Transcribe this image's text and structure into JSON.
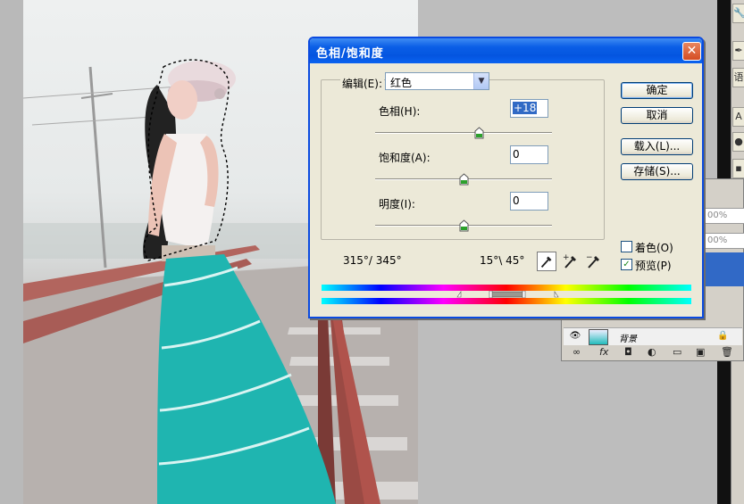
{
  "dialog": {
    "title": "色相/饱和度",
    "close_symbol": "✕",
    "edit_label": "编辑(E):",
    "edit_value": "红色",
    "hue_label": "色相(H):",
    "hue_value": "+18",
    "saturation_label": "饱和度(A):",
    "saturation_value": "0",
    "lightness_label": "明度(I):",
    "lightness_value": "0",
    "ok_label": "确定",
    "cancel_label": "取消",
    "load_label": "载入(L)...",
    "save_label": "存储(S)...",
    "colorize_label": "着色(O)",
    "preview_label": "预览(P)",
    "colorize_checked": false,
    "preview_checked": true,
    "range_left": "315°/ 345°",
    "range_right": "15°\\ 45°",
    "slider_positions": {
      "hue": 0.59,
      "saturation": 0.5,
      "lightness": 0.5
    }
  },
  "layers": {
    "opacity_1": "00%",
    "opacity_2": "00%",
    "layer_name": "背景",
    "footer_icons": [
      "link-icon",
      "fx-icon",
      "mask-icon",
      "adjustment-icon",
      "folder-icon",
      "new-layer-icon",
      "trash-icon"
    ]
  },
  "tools": {
    "cells": [
      "🔧",
      "✒",
      "语",
      "A",
      "●",
      "▪"
    ]
  },
  "colors": {
    "title_blue": "#0a5ee6",
    "close_red": "#d54c22",
    "skirt_teal": "#1fb5b0",
    "selection_blue": "#316ac5"
  }
}
